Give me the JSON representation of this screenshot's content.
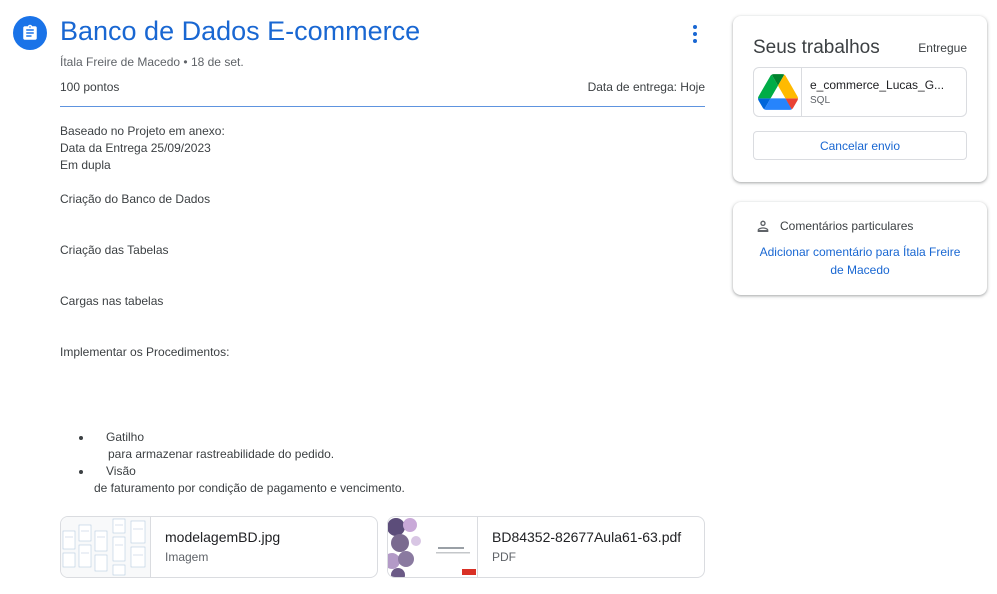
{
  "assignment": {
    "title": "Banco de Dados E-commerce",
    "author": "Ítala Freire de Macedo",
    "date": "18 de set.",
    "points": "100 pontos",
    "due": "Data de entrega: Hoje",
    "accent_color": "#1967d2"
  },
  "description": {
    "intro": [
      "Baseado no Projeto em anexo:",
      "Data da Entrega 25/09/2023",
      "Em dupla"
    ],
    "step1": "Criação do Banco de Dados",
    "step2": "Criação das Tabelas",
    "step3": "Cargas nas tabelas",
    "step4": "Implementar os Procedimentos:",
    "bullets": [
      {
        "title": "Gatilho",
        "detail": "para armazenar rastreabilidade do pedido."
      },
      {
        "title": "Visão",
        "detail": "de faturamento por condição de pagamento e vencimento."
      }
    ]
  },
  "attachments": [
    {
      "name": "modelagemBD.jpg",
      "type": "Imagem"
    },
    {
      "name": "BD84352-82677Aula61-63.pdf",
      "type": "PDF"
    }
  ],
  "your_work": {
    "title": "Seus trabalhos",
    "status": "Entregue",
    "file_name": "e_commerce_Lucas_G...",
    "file_type": "SQL",
    "cancel_label": "Cancelar envio"
  },
  "private_comments": {
    "title": "Comentários particulares",
    "add_link": "Adicionar comentário para Ítala Freire de Macedo"
  },
  "icons": {
    "assignment": "assignment-icon",
    "more": "more-vert-icon",
    "drive": "google-drive-icon",
    "person": "person-icon"
  }
}
